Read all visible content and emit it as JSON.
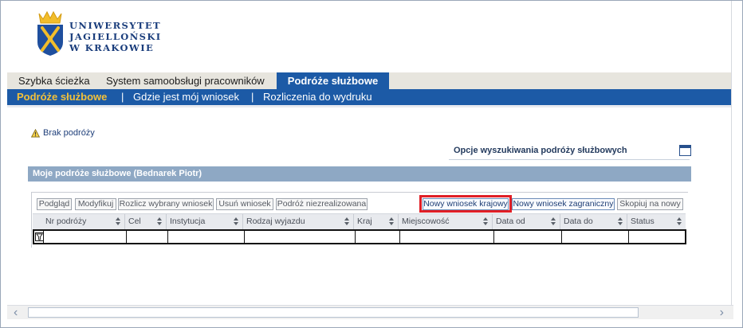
{
  "logo": {
    "lines": [
      "UNIWERSYTET",
      "JAGIELLOŃSKI",
      "W KRAKOWIE"
    ]
  },
  "tabs": [
    {
      "label": "Szybka ścieżka"
    },
    {
      "label": "System samoobsługi pracowników"
    },
    {
      "label": "Podróże służbowe"
    }
  ],
  "subnav": {
    "current": "Podróże służbowe",
    "separator": "|",
    "items": [
      "Gdzie jest mój wniosek",
      "Rozliczenia do wydruku"
    ]
  },
  "info": {
    "message": "Brak podróży",
    "icon": "warning-icon"
  },
  "search": {
    "label": "Opcje wyszukiwania podróży służbowych",
    "icon": "calendar-icon"
  },
  "section": {
    "title": "Moje podróże służbowe (Bednarek Piotr)"
  },
  "toolbar": {
    "left_buttons": [
      "Podgląd",
      "Modyfikuj",
      "Rozlicz wybrany wniosek",
      "Usuń wniosek",
      "Podróż niezrealizowana"
    ],
    "right_buttons": [
      "Nowy wniosek krajowy",
      "Nowy wniosek zagraniczny",
      "Skopiuj na nowy"
    ]
  },
  "table": {
    "columns": [
      "Nr podróży",
      "Cel",
      "Instytucja",
      "Rodzaj wyjazdu",
      "Kraj",
      "Miejscowość",
      "Data od",
      "Data do",
      "Status"
    ],
    "filter_icon": "filter-icon"
  },
  "colors": {
    "brand_blue": "#1c5aa6",
    "active_subnav": "#f3c13a",
    "highlight": "#e01f26",
    "section_bar": "#8ea8c4"
  }
}
